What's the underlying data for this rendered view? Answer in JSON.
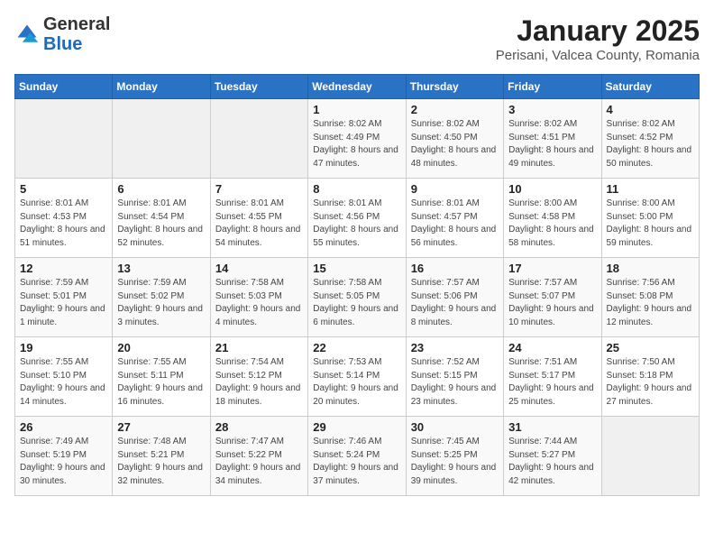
{
  "logo": {
    "general": "General",
    "blue": "Blue"
  },
  "header": {
    "month": "January 2025",
    "location": "Perisani, Valcea County, Romania"
  },
  "days_of_week": [
    "Sunday",
    "Monday",
    "Tuesday",
    "Wednesday",
    "Thursday",
    "Friday",
    "Saturday"
  ],
  "weeks": [
    [
      {
        "day": "",
        "info": ""
      },
      {
        "day": "",
        "info": ""
      },
      {
        "day": "",
        "info": ""
      },
      {
        "day": "1",
        "info": "Sunrise: 8:02 AM\nSunset: 4:49 PM\nDaylight: 8 hours and 47 minutes."
      },
      {
        "day": "2",
        "info": "Sunrise: 8:02 AM\nSunset: 4:50 PM\nDaylight: 8 hours and 48 minutes."
      },
      {
        "day": "3",
        "info": "Sunrise: 8:02 AM\nSunset: 4:51 PM\nDaylight: 8 hours and 49 minutes."
      },
      {
        "day": "4",
        "info": "Sunrise: 8:02 AM\nSunset: 4:52 PM\nDaylight: 8 hours and 50 minutes."
      }
    ],
    [
      {
        "day": "5",
        "info": "Sunrise: 8:01 AM\nSunset: 4:53 PM\nDaylight: 8 hours and 51 minutes."
      },
      {
        "day": "6",
        "info": "Sunrise: 8:01 AM\nSunset: 4:54 PM\nDaylight: 8 hours and 52 minutes."
      },
      {
        "day": "7",
        "info": "Sunrise: 8:01 AM\nSunset: 4:55 PM\nDaylight: 8 hours and 54 minutes."
      },
      {
        "day": "8",
        "info": "Sunrise: 8:01 AM\nSunset: 4:56 PM\nDaylight: 8 hours and 55 minutes."
      },
      {
        "day": "9",
        "info": "Sunrise: 8:01 AM\nSunset: 4:57 PM\nDaylight: 8 hours and 56 minutes."
      },
      {
        "day": "10",
        "info": "Sunrise: 8:00 AM\nSunset: 4:58 PM\nDaylight: 8 hours and 58 minutes."
      },
      {
        "day": "11",
        "info": "Sunrise: 8:00 AM\nSunset: 5:00 PM\nDaylight: 8 hours and 59 minutes."
      }
    ],
    [
      {
        "day": "12",
        "info": "Sunrise: 7:59 AM\nSunset: 5:01 PM\nDaylight: 9 hours and 1 minute."
      },
      {
        "day": "13",
        "info": "Sunrise: 7:59 AM\nSunset: 5:02 PM\nDaylight: 9 hours and 3 minutes."
      },
      {
        "day": "14",
        "info": "Sunrise: 7:58 AM\nSunset: 5:03 PM\nDaylight: 9 hours and 4 minutes."
      },
      {
        "day": "15",
        "info": "Sunrise: 7:58 AM\nSunset: 5:05 PM\nDaylight: 9 hours and 6 minutes."
      },
      {
        "day": "16",
        "info": "Sunrise: 7:57 AM\nSunset: 5:06 PM\nDaylight: 9 hours and 8 minutes."
      },
      {
        "day": "17",
        "info": "Sunrise: 7:57 AM\nSunset: 5:07 PM\nDaylight: 9 hours and 10 minutes."
      },
      {
        "day": "18",
        "info": "Sunrise: 7:56 AM\nSunset: 5:08 PM\nDaylight: 9 hours and 12 minutes."
      }
    ],
    [
      {
        "day": "19",
        "info": "Sunrise: 7:55 AM\nSunset: 5:10 PM\nDaylight: 9 hours and 14 minutes."
      },
      {
        "day": "20",
        "info": "Sunrise: 7:55 AM\nSunset: 5:11 PM\nDaylight: 9 hours and 16 minutes."
      },
      {
        "day": "21",
        "info": "Sunrise: 7:54 AM\nSunset: 5:12 PM\nDaylight: 9 hours and 18 minutes."
      },
      {
        "day": "22",
        "info": "Sunrise: 7:53 AM\nSunset: 5:14 PM\nDaylight: 9 hours and 20 minutes."
      },
      {
        "day": "23",
        "info": "Sunrise: 7:52 AM\nSunset: 5:15 PM\nDaylight: 9 hours and 23 minutes."
      },
      {
        "day": "24",
        "info": "Sunrise: 7:51 AM\nSunset: 5:17 PM\nDaylight: 9 hours and 25 minutes."
      },
      {
        "day": "25",
        "info": "Sunrise: 7:50 AM\nSunset: 5:18 PM\nDaylight: 9 hours and 27 minutes."
      }
    ],
    [
      {
        "day": "26",
        "info": "Sunrise: 7:49 AM\nSunset: 5:19 PM\nDaylight: 9 hours and 30 minutes."
      },
      {
        "day": "27",
        "info": "Sunrise: 7:48 AM\nSunset: 5:21 PM\nDaylight: 9 hours and 32 minutes."
      },
      {
        "day": "28",
        "info": "Sunrise: 7:47 AM\nSunset: 5:22 PM\nDaylight: 9 hours and 34 minutes."
      },
      {
        "day": "29",
        "info": "Sunrise: 7:46 AM\nSunset: 5:24 PM\nDaylight: 9 hours and 37 minutes."
      },
      {
        "day": "30",
        "info": "Sunrise: 7:45 AM\nSunset: 5:25 PM\nDaylight: 9 hours and 39 minutes."
      },
      {
        "day": "31",
        "info": "Sunrise: 7:44 AM\nSunset: 5:27 PM\nDaylight: 9 hours and 42 minutes."
      },
      {
        "day": "",
        "info": ""
      }
    ]
  ]
}
